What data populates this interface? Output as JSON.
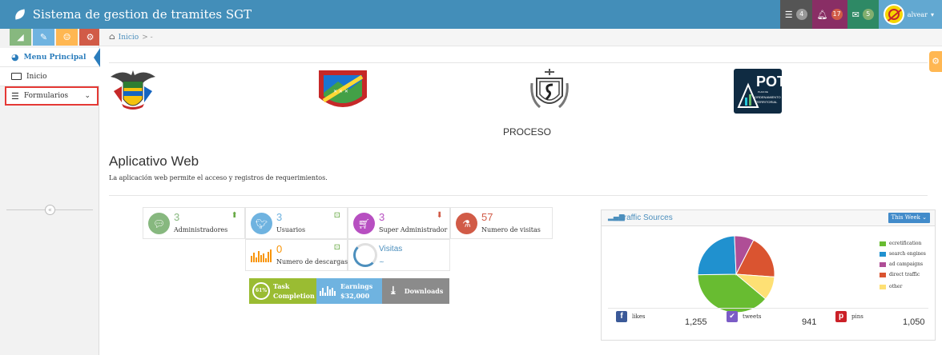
{
  "navbar": {
    "brand": "Sistema de gestion de tramites SGT",
    "tasks_count": "4",
    "notifications_count": "17",
    "messages_count": "5",
    "user_name": "alvear"
  },
  "sidebar": {
    "shortcut_icons": [
      "chart-icon",
      "pencil-icon",
      "users-icon",
      "cogs-icon"
    ],
    "menu_principal": "Menu Principal",
    "inicio": "Inicio",
    "formularios": "Formularios"
  },
  "breadcrumb": {
    "home": "Inicio",
    "sep": "> -"
  },
  "logos": {
    "pot_title": "POT",
    "pot_line1": "PLAN DE",
    "pot_line2": "ORDENAMIENTO",
    "pot_line3": "TERRITORIAL"
  },
  "proceso": "PROCESO",
  "app": {
    "title": "Aplicativo Web",
    "description": "La aplicación web permite el acceso y registros de requerimientos."
  },
  "stats": [
    {
      "value": "3",
      "label": "Administradores",
      "color": "#87b87f"
    },
    {
      "value": "3",
      "label": "Usuarios",
      "color": "#6fb3e0"
    },
    {
      "value": "3",
      "label": "Super Administrador",
      "color": "#b74fc1"
    },
    {
      "value": "57",
      "label": "Numero de visitas",
      "color": "#d15b47"
    },
    {
      "value": "0",
      "label": "Numero de descargas",
      "color": "#f89406"
    },
    {
      "value": "Visitas",
      "label": "~",
      "color": "#4c8fbd"
    }
  ],
  "infoboxes": {
    "task_pct": "61%",
    "task_label1": "Task",
    "task_label2": "Completion",
    "earnings_label": "Earnings",
    "earnings_value": "$32,000",
    "downloads_label": "Downloads"
  },
  "traffic": {
    "title": "Traffic Sources",
    "range_button": "This Week",
    "legend": [
      {
        "name": "ecretification",
        "color": "#68bc31"
      },
      {
        "name": "search engines",
        "color": "#2091cf"
      },
      {
        "name": "ad campaigns",
        "color": "#af4e96"
      },
      {
        "name": "direct traffic",
        "color": "#da5430"
      },
      {
        "name": "other",
        "color": "#fee074"
      }
    ],
    "chart_data": {
      "type": "pie",
      "categories": [
        "ecretification",
        "search engines",
        "ad campaigns",
        "direct traffic",
        "other"
      ],
      "values": [
        38.7,
        24.5,
        8.2,
        18.6,
        10.0
      ]
    },
    "social": [
      {
        "icon": "facebook-icon",
        "label": "likes",
        "value": "1,255",
        "color": "#3b5998"
      },
      {
        "icon": "twitter-icon",
        "label": "tweets",
        "value": "941",
        "color": "#7b5cc6"
      },
      {
        "icon": "pinterest-icon",
        "label": "pins",
        "value": "1,050",
        "color": "#cb2027"
      }
    ]
  }
}
